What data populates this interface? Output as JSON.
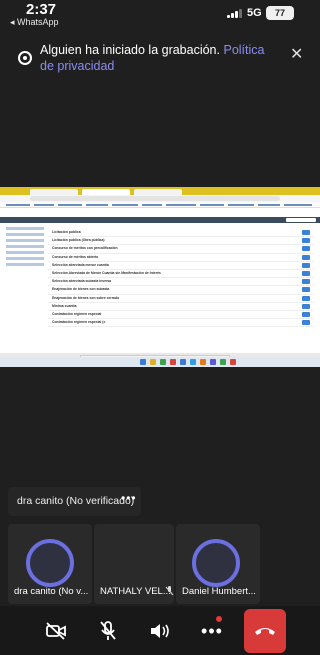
{
  "status_bar": {
    "time": "2:37",
    "back_app": "◂ WhatsApp",
    "network": "5G",
    "battery": "77"
  },
  "recording_banner": {
    "message": "Alguien ha iniciado la grabación.",
    "link": "Política de privacidad",
    "close": "✕"
  },
  "shared_screen": {
    "procedures": [
      "Licitación pública",
      "Licitación pública (Obra pública)",
      "Concurso de méritos con precalificación",
      "Concurso de méritos abierto",
      "Selección abreviada menor cuantía",
      "Selección Abreviada de Menor Cuantía sin Manifestación de Interés",
      "Selección abreviada subasta inversa",
      "Enajenación de bienes con subasta",
      "Enajenación de bienes con sobre cerrado",
      "Mínima cuantía",
      "Contratación régimen especial",
      "Contratación régimen especial (c"
    ]
  },
  "speaker": {
    "name": "dra canito (No verificado)",
    "more": "•••"
  },
  "participants": [
    {
      "name": "dra canito (No v...",
      "has_avatar": true
    },
    {
      "name": "NATHALY VEL...",
      "has_avatar": false
    },
    {
      "name": "Daniel Humbert...",
      "has_avatar": true
    }
  ],
  "toolbar": {
    "items": [
      "camera-off",
      "mic-off",
      "speaker",
      "more",
      "hang-up"
    ],
    "accent": "#d83a3a"
  },
  "colors": {
    "background": "#1f1f1f",
    "avatar_ring": "#6b6fe0",
    "link": "#8b8df0"
  }
}
